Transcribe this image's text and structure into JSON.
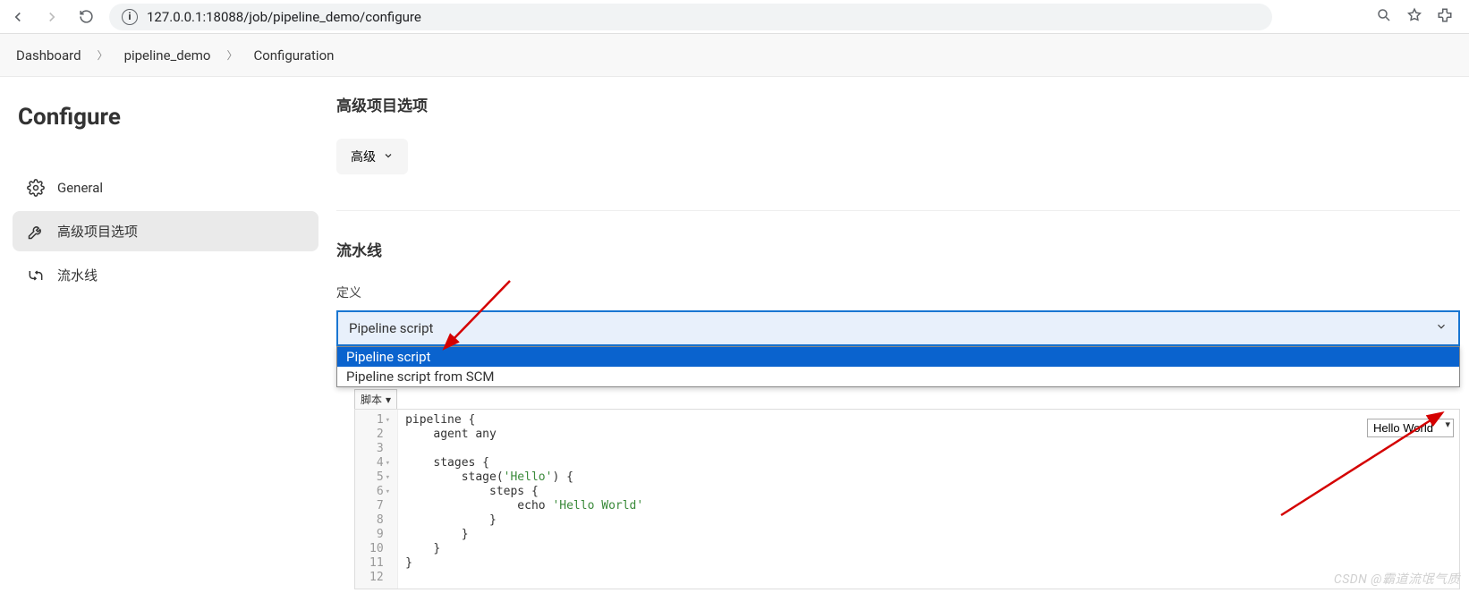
{
  "browser": {
    "url": "127.0.0.1:18088/job/pipeline_demo/configure"
  },
  "breadcrumb": {
    "items": [
      "Dashboard",
      "pipeline_demo",
      "Configuration"
    ]
  },
  "page": {
    "title": "Configure"
  },
  "sidebar": {
    "items": [
      {
        "label": "General"
      },
      {
        "label": "高级项目选项"
      },
      {
        "label": "流水线"
      }
    ]
  },
  "main": {
    "advanced_heading": "高级项目选项",
    "advanced_button": "高级",
    "pipeline_heading": "流水线",
    "definition_label": "定义",
    "definition_selected": "Pipeline script",
    "definition_options": [
      "Pipeline script",
      "Pipeline script from SCM"
    ],
    "script_tab": "脚本",
    "sample_select": "Hello World",
    "code": {
      "lines": [
        {
          "n": 1,
          "fold": true,
          "text": "pipeline {"
        },
        {
          "n": 2,
          "fold": false,
          "text": "    agent any"
        },
        {
          "n": 3,
          "fold": false,
          "text": ""
        },
        {
          "n": 4,
          "fold": true,
          "text": "    stages {"
        },
        {
          "n": 5,
          "fold": true,
          "text": "        stage('Hello') {"
        },
        {
          "n": 6,
          "fold": true,
          "text": "            steps {"
        },
        {
          "n": 7,
          "fold": false,
          "text": "                echo 'Hello World'"
        },
        {
          "n": 8,
          "fold": false,
          "text": "            }"
        },
        {
          "n": 9,
          "fold": false,
          "text": "        }"
        },
        {
          "n": 10,
          "fold": false,
          "text": "    }"
        },
        {
          "n": 11,
          "fold": false,
          "text": "}"
        },
        {
          "n": 12,
          "fold": false,
          "text": ""
        }
      ]
    }
  },
  "watermark": "CSDN @霸道流氓气质"
}
